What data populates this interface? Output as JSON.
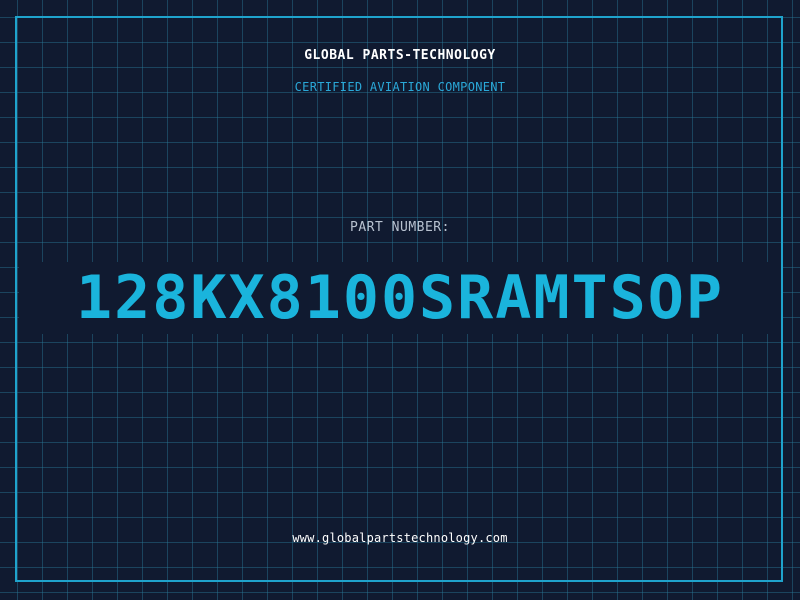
{
  "header": {
    "company": "GLOBAL PARTS-TECHNOLOGY",
    "subtitle": "CERTIFIED AVIATION COMPONENT"
  },
  "part": {
    "label": "PART NUMBER:",
    "number": "128KX8100SRAMTSOP"
  },
  "footer": {
    "website": "www.globalpartstechnology.com"
  },
  "colors": {
    "background": "#101a30",
    "grid": "#28789a",
    "accent": "#1ab4dc",
    "frame": "#1fa3cc",
    "label": "#b8c2d0",
    "text": "#ffffff"
  }
}
